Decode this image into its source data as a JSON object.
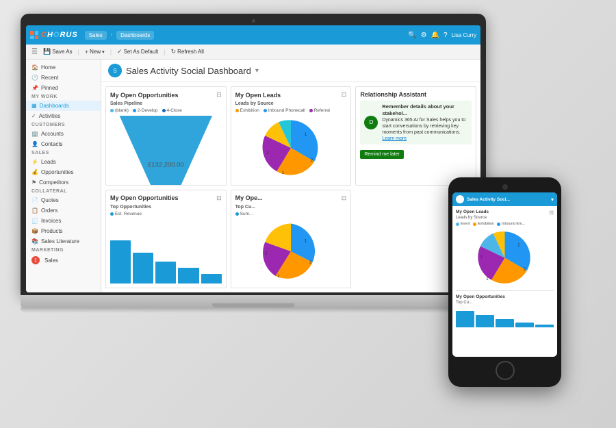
{
  "app": {
    "topbar": {
      "logo": "CHORUS",
      "nav_items": [
        "Sales",
        "Dashboards"
      ],
      "user_name": "Lisa Curry"
    },
    "secondbar": {
      "buttons": [
        "Save As",
        "New",
        "Set As Default",
        "Refresh All"
      ]
    },
    "page_title": "Sales Activity Social Dashboard",
    "sidebar": {
      "nav": [
        {
          "label": "Home",
          "icon": "🏠",
          "section": ""
        },
        {
          "label": "Recent",
          "icon": "🕐",
          "section": ""
        },
        {
          "label": "Pinned",
          "icon": "📌",
          "section": ""
        }
      ],
      "sections": [
        {
          "title": "My Work",
          "items": [
            {
              "label": "Dashboards",
              "icon": "📊",
              "active": true
            },
            {
              "label": "Activities",
              "icon": "✓"
            }
          ]
        },
        {
          "title": "Customers",
          "items": [
            {
              "label": "Accounts",
              "icon": "🏢"
            },
            {
              "label": "Contacts",
              "icon": "👤"
            }
          ]
        },
        {
          "title": "Sales",
          "items": [
            {
              "label": "Leads",
              "icon": "⚡"
            },
            {
              "label": "Opportunities",
              "icon": "💰"
            },
            {
              "label": "Competitors",
              "icon": "🔰"
            }
          ]
        },
        {
          "title": "Collateral",
          "items": [
            {
              "label": "Quotes",
              "icon": "📄"
            },
            {
              "label": "Orders",
              "icon": "📋"
            },
            {
              "label": "Invoices",
              "icon": "🧾"
            },
            {
              "label": "Products",
              "icon": "📦"
            },
            {
              "label": "Sales Literature",
              "icon": "📚"
            }
          ]
        },
        {
          "title": "Marketing",
          "items": [
            {
              "label": "Sales",
              "icon": "📈"
            }
          ]
        }
      ]
    },
    "dashboard": {
      "cards": [
        {
          "id": "open-opportunities",
          "title": "My Open Opportunities",
          "subtitle": "Sales Pipeline",
          "legend": [
            "(blank)",
            "2-Develop",
            "4-Close"
          ],
          "legend_colors": [
            "#4db6e8",
            "#2196f3",
            "#1565c0"
          ],
          "chart_type": "funnel",
          "value": "£132,200.00"
        },
        {
          "id": "open-leads",
          "title": "My Open Leads",
          "subtitle": "Leads by Source",
          "legend": [
            "Exhibition",
            "Inbound Phonecall",
            "Referral"
          ],
          "legend_colors": [
            "#ff9800",
            "#2196f3",
            "#9c27b0"
          ],
          "chart_type": "pie"
        },
        {
          "id": "relationship-assistant",
          "title": "Relationship Assistant",
          "chart_type": "info",
          "ra_bold": "Remember details about your stakehol...",
          "ra_text": "Dynamics 365 AI for Sales helps you to start conversations by retrieving key moments from past communications.",
          "ra_link": "Learn more",
          "ra_button": "Remind me later"
        },
        {
          "id": "open-opportunities-2",
          "title": "My Open Opportunities",
          "subtitle": "Top Opportunities",
          "legend": [
            "Est. Revenue"
          ],
          "legend_colors": [
            "#1a9bd7"
          ],
          "chart_type": "bar"
        },
        {
          "id": "open-customers",
          "title": "My Ope...",
          "subtitle": "Top Cu...",
          "legend": [
            "Sum..."
          ],
          "legend_colors": [
            "#1a9bd7"
          ],
          "chart_type": "pie-small"
        }
      ]
    }
  },
  "phone": {
    "title": "Sales Activity Soci...",
    "section1_title": "My Open Leads",
    "section1_subtitle": "Leads by Source",
    "legend": [
      "Event",
      "Exhibition",
      "Inbound Em..."
    ],
    "legend_colors": [
      "#4db6e8",
      "#ff9800",
      "#2196f3"
    ],
    "section2_title": "My Open Opportunities",
    "section2_subtitle": "Top Cu..."
  }
}
